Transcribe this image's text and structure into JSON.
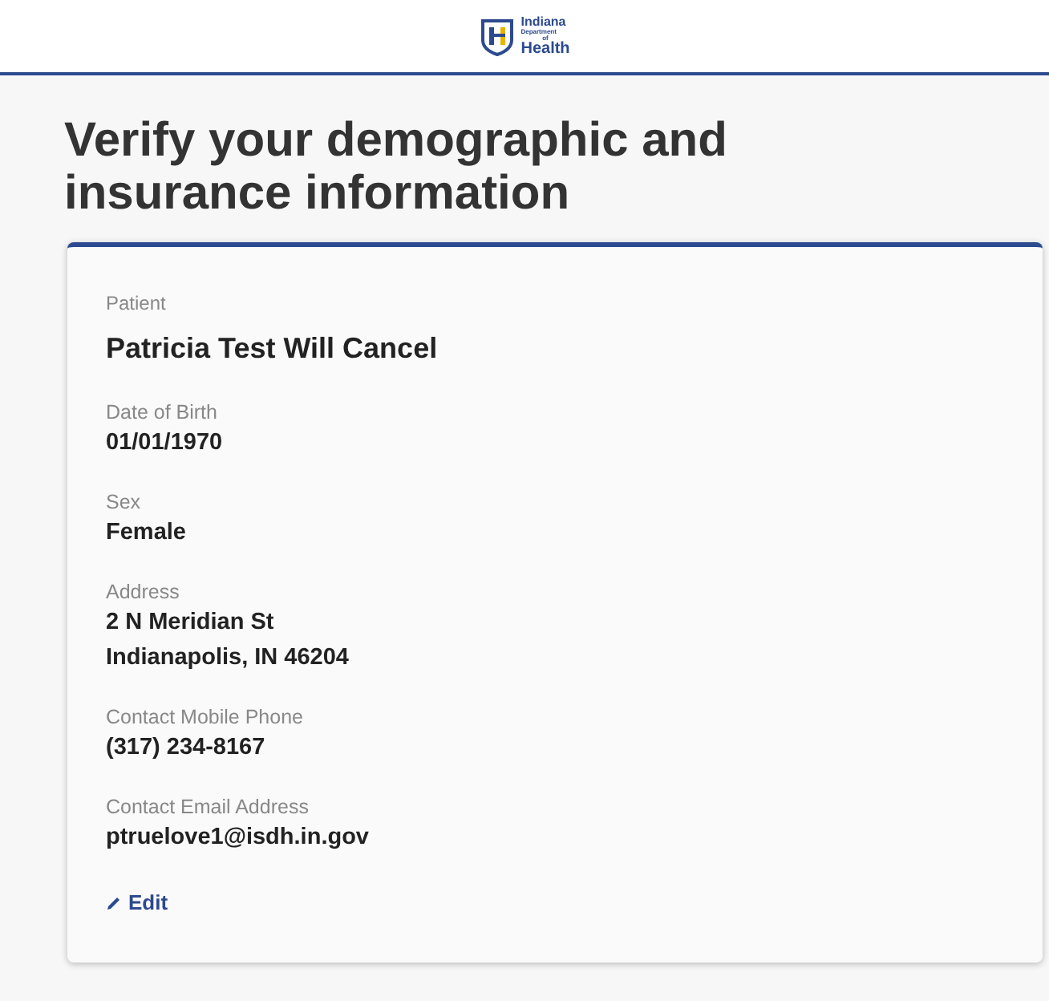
{
  "logo": {
    "lines": [
      "Indiana",
      "Department",
      "of",
      "Health"
    ]
  },
  "title": "Verify your demographic and insurance information",
  "patient": {
    "label": "Patient",
    "value": "Patricia Test Will Cancel"
  },
  "fields": [
    {
      "label": "Date of Birth",
      "lines": [
        "01/01/1970"
      ]
    },
    {
      "label": "Sex",
      "lines": [
        "Female"
      ]
    },
    {
      "label": "Address",
      "lines": [
        "2 N Meridian St",
        "Indianapolis, IN 46204"
      ]
    },
    {
      "label": "Contact Mobile Phone",
      "lines": [
        "(317) 234-8167"
      ]
    },
    {
      "label": "Contact Email Address",
      "lines": [
        "ptruelove1@isdh.in.gov"
      ]
    }
  ],
  "edit_link": "Edit"
}
